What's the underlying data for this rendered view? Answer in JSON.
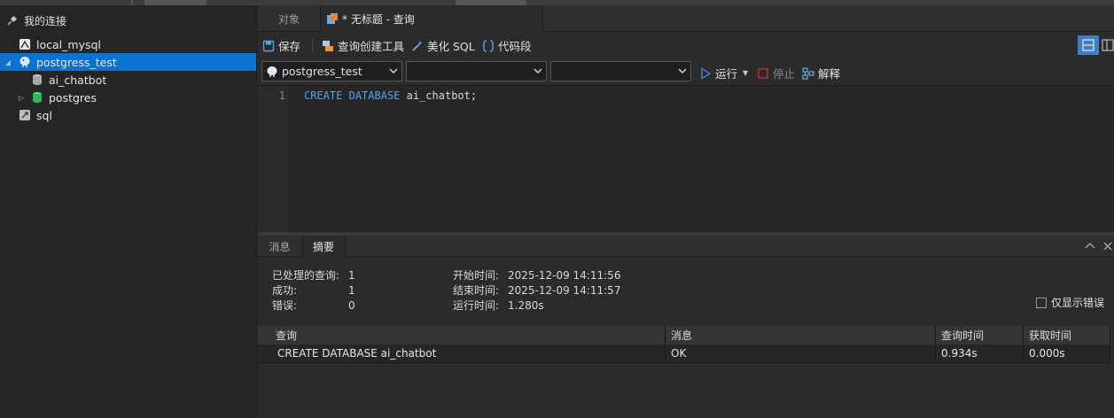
{
  "sidebar": {
    "header": "我的连接",
    "items": [
      {
        "label": "local_mysql",
        "icon": "mysql-connection-icon"
      },
      {
        "label": "postgress_test",
        "icon": "postgres-connection-icon",
        "selected": true
      },
      {
        "label": "ai_chatbot",
        "icon": "database-icon-gray"
      },
      {
        "label": "postgres",
        "icon": "database-icon-green"
      },
      {
        "label": "sql",
        "icon": "connection-icon"
      }
    ]
  },
  "tabs": {
    "objects": "对象",
    "query": "* 无标题 - 查询"
  },
  "toolbar": {
    "save": "保存",
    "query_builder": "查询创建工具",
    "beautify": "美化 SQL",
    "snippet": "代码段",
    "run": "运行",
    "stop": "停止",
    "explain": "解释"
  },
  "selectors": {
    "connection": "postgress_test",
    "database": "",
    "schema": ""
  },
  "editor": {
    "line_number": "1",
    "kw1": "CREATE",
    "kw2": "DATABASE",
    "ident": "ai_chatbot;"
  },
  "result_tabs": {
    "messages": "消息",
    "summary": "摘要"
  },
  "summary": {
    "processed_label": "已处理的查询:",
    "processed_value": "1",
    "success_label": "成功:",
    "success_value": "1",
    "error_label": "错误:",
    "error_value": "0",
    "start_label": "开始时间:",
    "start_value": "2025-12-09 14:11:56",
    "end_label": "结束时间:",
    "end_value": "2025-12-09 14:11:57",
    "run_label": "运行时间:",
    "run_value": "1.280s"
  },
  "show_errors_only": "仅显示错误",
  "results_table": {
    "columns": [
      "查询",
      "消息",
      "查询时间",
      "获取时间"
    ],
    "rows": [
      [
        "CREATE DATABASE ai_chatbot",
        "OK",
        "0.934s",
        "0.000s"
      ]
    ]
  },
  "colors": {
    "selection": "#0a72d1",
    "keyword": "#4ea4ff",
    "run_icon": "#3d8fe0",
    "stop_icon": "#c0392b"
  }
}
